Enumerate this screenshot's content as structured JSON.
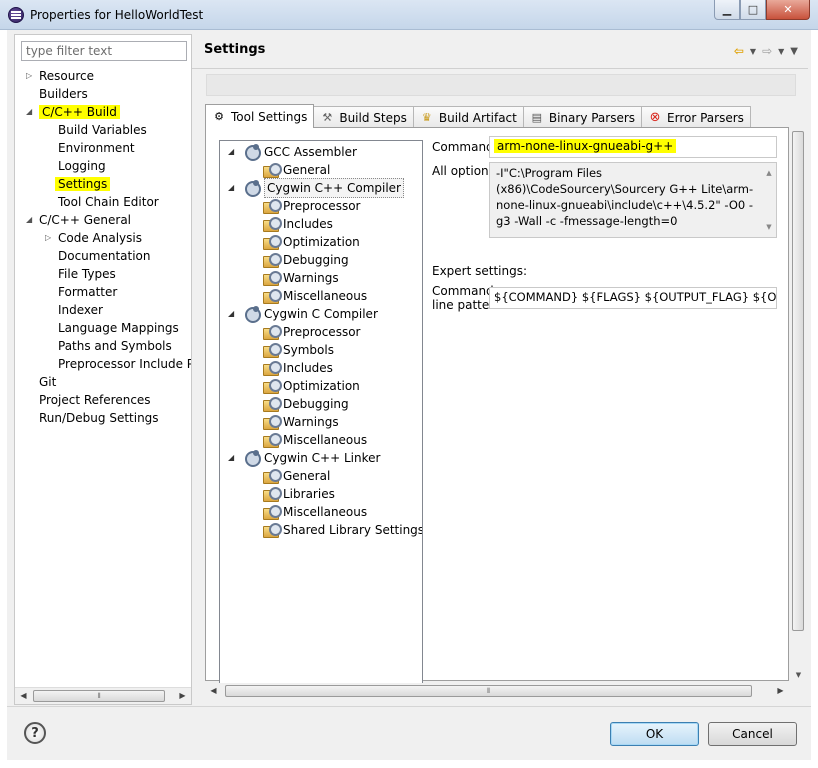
{
  "window": {
    "title": "Properties for HelloWorldTest",
    "minimize_label": "▁",
    "maximize_label": "□",
    "close_label": "✕"
  },
  "filter": {
    "placeholder": "type filter text"
  },
  "nav": {
    "resource": "Resource",
    "builders": "Builders",
    "cc_build": "C/C++ Build",
    "build_variables": "Build Variables",
    "environment": "Environment",
    "logging": "Logging",
    "settings": "Settings",
    "tool_chain_editor": "Tool Chain Editor",
    "cc_general": "C/C++ General",
    "code_analysis": "Code Analysis",
    "documentation": "Documentation",
    "file_types": "File Types",
    "formatter": "Formatter",
    "indexer": "Indexer",
    "language_mappings": "Language Mappings",
    "paths_and_symbols": "Paths and Symbols",
    "preprocessor_include": "Preprocessor Include Pa",
    "git": "Git",
    "project_references": "Project References",
    "run_debug_settings": "Run/Debug Settings"
  },
  "header": {
    "title": "Settings"
  },
  "tabs": {
    "tool_settings": "Tool Settings",
    "build_steps": "Build Steps",
    "build_artifact": "Build Artifact",
    "binary_parsers": "Binary Parsers",
    "error_parsers": "Error Parsers"
  },
  "tool_tree": {
    "gcc_assembler": "GCC Assembler",
    "gcc_assembler_general": "General",
    "cpp_compiler": "Cygwin C++ Compiler",
    "cpp_preprocessor": "Preprocessor",
    "cpp_includes": "Includes",
    "cpp_optimization": "Optimization",
    "cpp_debugging": "Debugging",
    "cpp_warnings": "Warnings",
    "cpp_misc": "Miscellaneous",
    "c_compiler": "Cygwin C Compiler",
    "c_preprocessor": "Preprocessor",
    "c_symbols": "Symbols",
    "c_includes": "Includes",
    "c_optimization": "Optimization",
    "c_debugging": "Debugging",
    "c_warnings": "Warnings",
    "c_misc": "Miscellaneous",
    "cpp_linker": "Cygwin C++ Linker",
    "linker_general": "General",
    "linker_libraries": "Libraries",
    "linker_misc": "Miscellaneous",
    "linker_shared": "Shared Library Settings"
  },
  "form": {
    "command_label": "Command:",
    "command_value": "arm-none-linux-gnueabi-g++",
    "all_options_label": "All options:",
    "all_options_value": "-I\"C:\\Program Files (x86)\\CodeSourcery\\Sourcery G++ Lite\\arm-none-linux-gnueabi\\include\\c++\\4.5.2\" -O0 -g3 -Wall -c -fmessage-length=0",
    "expert_label": "Expert settings:",
    "pattern_label_1": "Command",
    "pattern_label_2": "line pattern:",
    "pattern_value": "${COMMAND} ${FLAGS} ${OUTPUT_FLAG} ${OUTPUT_PREFIX}${OUTPUT} ${INPUTS}"
  },
  "buttons": {
    "help": "?",
    "ok": "OK",
    "cancel": "Cancel"
  },
  "colors": {
    "highlight": "#ffff00",
    "accent": "#3c7fb1"
  }
}
